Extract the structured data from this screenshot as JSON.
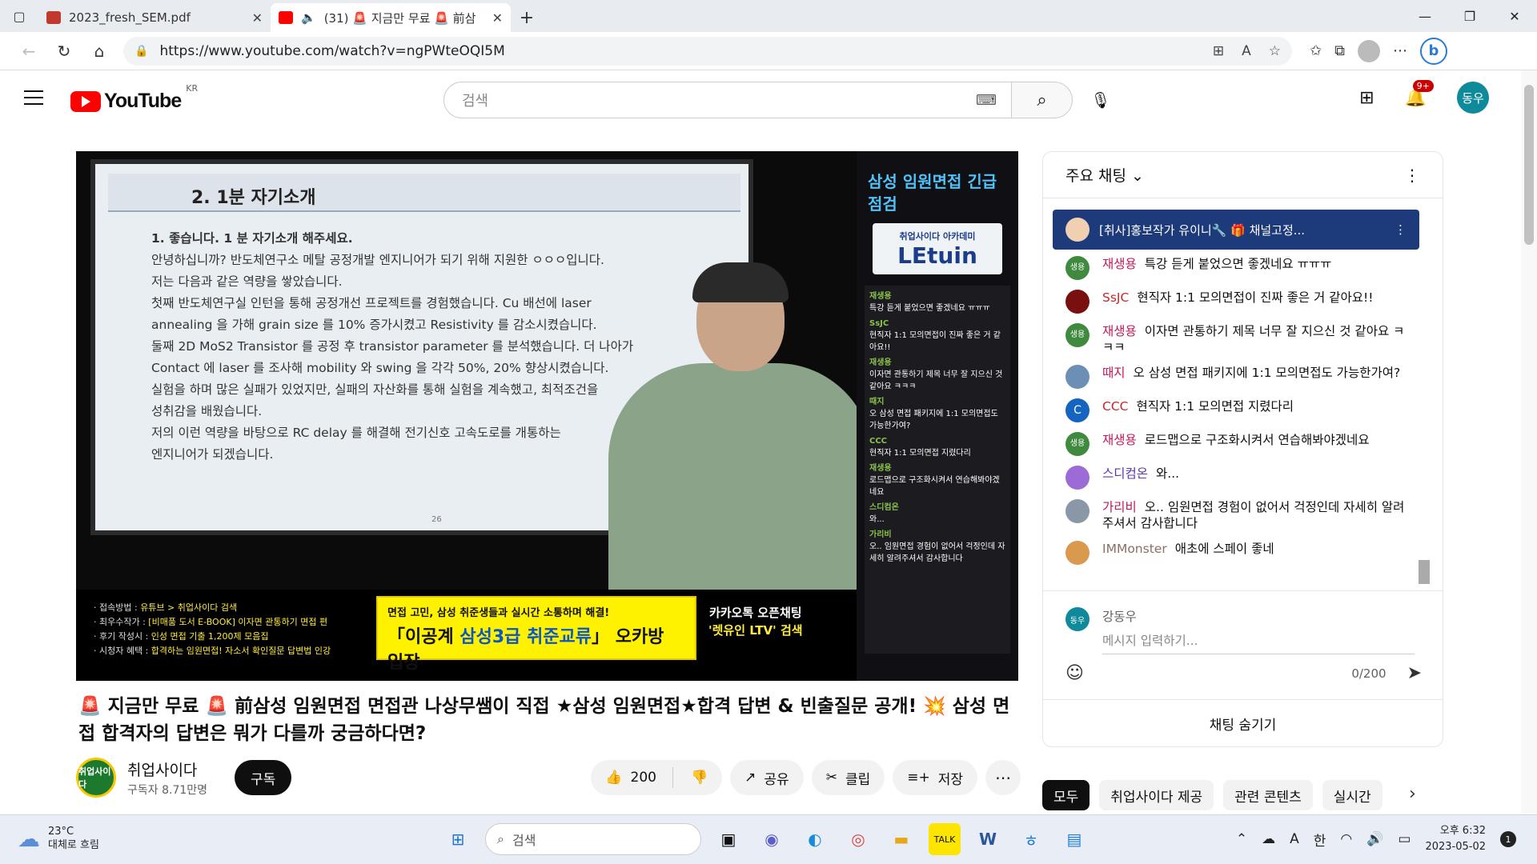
{
  "browser": {
    "tabs": [
      {
        "title": "2023_fresh_SEM.pdf",
        "icon": "pdf-icon",
        "active": false
      },
      {
        "title": "(31) 🚨 지금만 무료 🚨 前삼",
        "icon": "youtube-icon",
        "active": true
      }
    ],
    "url": "https://www.youtube.com/watch?v=ngPWteOQI5M"
  },
  "youtube": {
    "logo_text": "YouTube",
    "region": "KR",
    "search_placeholder": "검색",
    "notif_badge": "9+",
    "user_initials": "동우"
  },
  "video": {
    "slide_title": "2. 1분 자기소개",
    "slide_question": "1. 좋습니다. 1 분 자기소개 해주세요.",
    "slide_lines": [
      "안녕하십니까? 반도체연구소 메탈 공정개발 엔지니어가 되기 위해 지원한 ㅇㅇㅇ입니다.",
      "저는 다음과 같은 역량을 쌓았습니다.",
      "첫째 반도체연구실 인턴을 통해 공정개선 프로젝트를 경험했습니다. Cu 배선에 laser",
      "annealing 을 가해 grain size 를 10% 증가시켰고 Resistivity 를 감소시켰습니다.",
      "둘째 2D MoS2 Transistor 를 공정 후 transistor parameter 를 분석했습니다. 더 나아가",
      "Contact 에 laser 를 조사해 mobility 와 swing 을 각각 50%, 20% 향상시켰습니다.",
      "실험을 하며 많은 실패가 있었지만, 실패의 자산화를 통해 실험을 계속했고, 최적조건을",
      "성취감을 배웠습니다.",
      "저의 이런 역량을 바탕으로 RC delay 를 해결해 전기신호 고속도로를 개통하는",
      "엔지니어가 되겠습니다."
    ],
    "slide_page": "26",
    "side_title": "삼성 임원면접 긴급점검",
    "side_logo": "LEtuin",
    "side_logo_sub": "취업사이다 아카데미",
    "overlay_chat": [
      {
        "name": "재생용",
        "text": "특강 듣게 붙었으면 좋겠네요 ㅠㅠㅠ"
      },
      {
        "name": "SsJC",
        "text": "현직자 1:1 모의면접이 진짜 좋은 거 같아요!!"
      },
      {
        "name": "재생용",
        "text": "이자면 관통하기 제목 너무 잘 지으신 것 같아요 ㅋㅋㅋ"
      },
      {
        "name": "때지",
        "text": "오 삼성 면접 패키지에 1:1 모의면접도 가능한가여?"
      },
      {
        "name": "CCC",
        "text": "현직자 1:1 모의면접 지렸다리"
      },
      {
        "name": "재생용",
        "text": "로드맵으로 구조화시켜서 연습해봐야겠네요"
      },
      {
        "name": "스디컴온",
        "text": "와..."
      },
      {
        "name": "가리비",
        "text": "오.. 임원면접 경험이 없어서 걱정인데 자세히 알려주셔서 감사합니다"
      }
    ],
    "lower_left": [
      {
        "k": "· 접속방법 : ",
        "v": "유튜브 > 취업사이다 검색"
      },
      {
        "k": "· 최우수작가 : ",
        "v": "[비매품 도서 E-BOOK] 이자면 관통하기 면접 편"
      },
      {
        "k": "· 후기 작성시 : ",
        "v": "인성 면접 기출 1,200제 모음집"
      },
      {
        "k": "· 시청자 혜택 : ",
        "v": "합격하는 임원면접! 자소서 확인질문 답변법 인강"
      }
    ],
    "promo_line1": "면접 고민, 삼성 취준생들과 실시간 소통하며 해결!",
    "promo_prefix": "「이공계 ",
    "promo_highlight": "삼성3급 취준교류",
    "promo_suffix": "」 오카방 입장",
    "promo_right_1": "카카오톡 오픈채팅",
    "promo_right_2": "'렛유인 LTV' 검색",
    "title": "🚨 지금만 무료 🚨 前삼성 임원면접 면접관 나상무쌤이 직접 ★삼성 임원면접★합격 답변 & 빈출질문 공개! 💥 삼성 면접 합격자의 답변은 뭐가 다를까 궁금하다면?"
  },
  "channel": {
    "name": "취업사이다",
    "subscribers": "구독자 8.71만명",
    "subscribe_label": "구독",
    "avatar_text": "취업사이다"
  },
  "actions": {
    "likes": "200",
    "share": "공유",
    "clip": "클립",
    "save": "저장"
  },
  "chat": {
    "header": "주요 채팅",
    "pinned": "[취사]홍보작가 유이니🔧 🎁 채널고정...",
    "messages": [
      {
        "author": "재생용",
        "text": "특강 듣게 붙었으면 좋겠네요 ㅠㅠㅠ",
        "avatar_color": "#3f8a3f",
        "avatar_text": "생용",
        "role": "normal"
      },
      {
        "author": "SsJC",
        "text": "현직자 1:1 모의면접이 진짜 좋은 거 같아요!!",
        "avatar_color": "#7a0f0f",
        "avatar_text": "",
        "role": "member"
      },
      {
        "author": "재생용",
        "text": "이자면 관통하기 제목 너무 잘 지으신 것 같아요 ㅋㅋㅋ",
        "avatar_color": "#3f8a3f",
        "avatar_text": "생용",
        "role": "normal"
      },
      {
        "author": "때지",
        "text": "오 삼성 면접 패키지에 1:1 모의면접도 가능한가여?",
        "avatar_color": "#6b8fb5",
        "avatar_text": "",
        "role": "normal"
      },
      {
        "author": "CCC",
        "text": "현직자 1:1 모의면접 지렸다리",
        "avatar_color": "#1565c0",
        "avatar_text": "C",
        "role": "member"
      },
      {
        "author": "재생용",
        "text": "로드맵으로 구조화시켜서 연습해봐야겠네요",
        "avatar_color": "#3f8a3f",
        "avatar_text": "생용",
        "role": "normal"
      },
      {
        "author": "스디컴온",
        "text": "와...",
        "avatar_color": "#9c6bd6",
        "avatar_text": "",
        "role": "mod"
      },
      {
        "author": "가리비",
        "text": "오.. 임원면접 경험이 없어서 걱정인데 자세히 알려주셔서 감사합니다",
        "avatar_color": "#8a97a6",
        "avatar_text": "",
        "role": "normal"
      },
      {
        "author": "IMMonster",
        "text": "애초에 스페이 좋네",
        "avatar_color": "#d99a4e",
        "avatar_text": "",
        "role": "member"
      }
    ],
    "input_name": "강동우",
    "input_placeholder": "메시지 입력하기...",
    "counter": "0/200",
    "hide_label": "채팅 숨기기"
  },
  "chips": [
    "모두",
    "취업사이다 제공",
    "관련 콘텐츠",
    "실시간"
  ],
  "taskbar": {
    "temperature": "23°C",
    "weather": "대체로 흐림",
    "search_label": "검색",
    "time": "오후 6:32",
    "date": "2023-05-02",
    "notifications": "1",
    "lang": "한"
  }
}
